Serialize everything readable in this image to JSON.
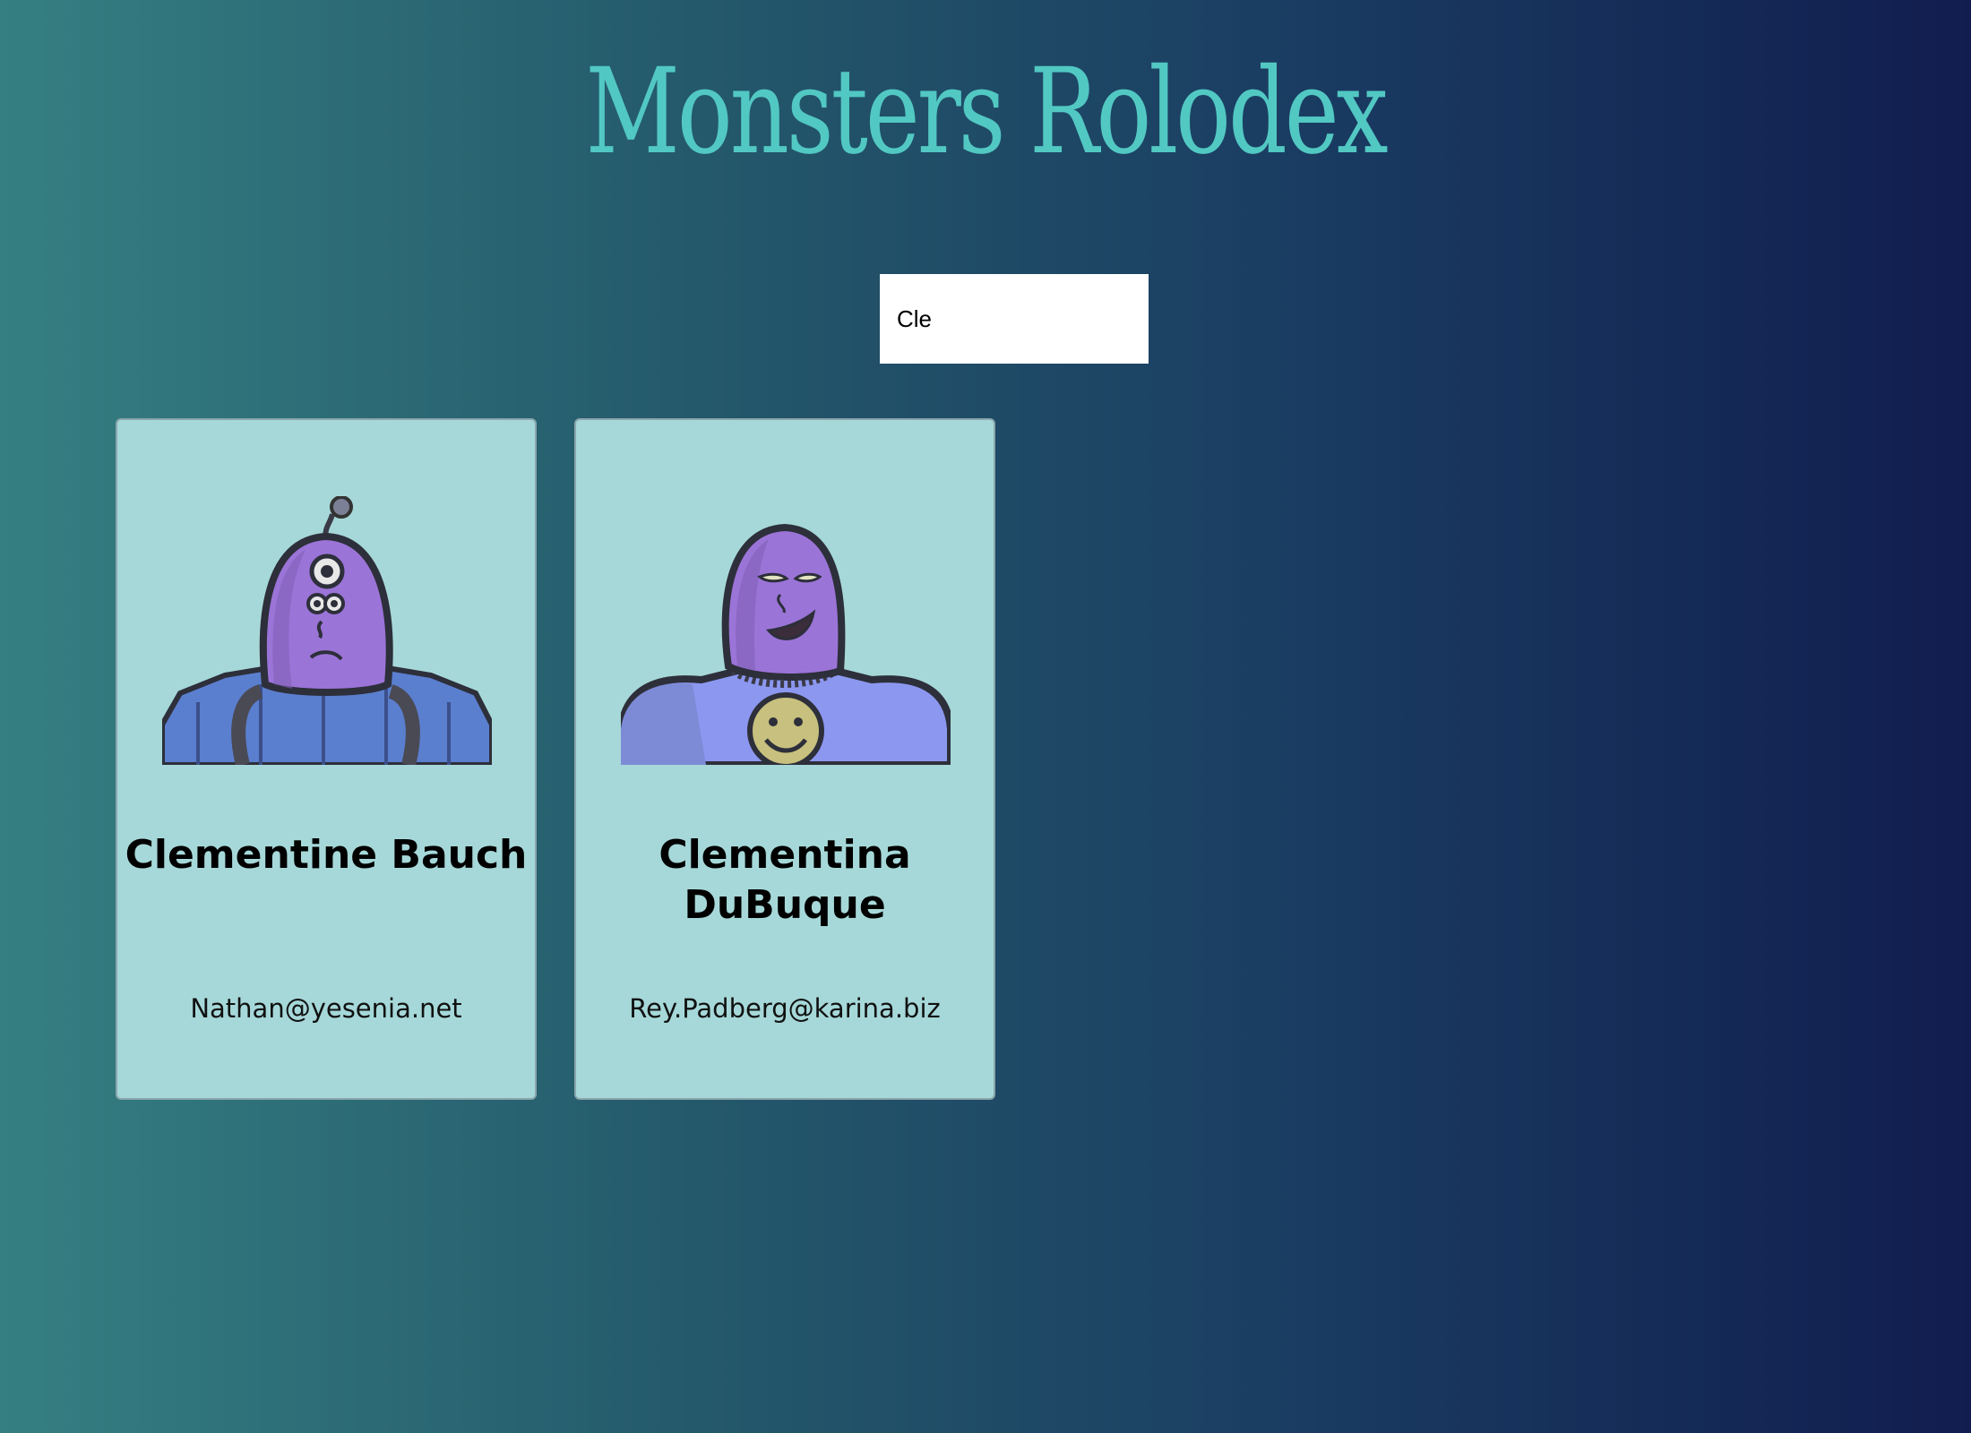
{
  "app": {
    "title": "Monsters Rolodex"
  },
  "search": {
    "value": "Cle",
    "placeholder": "search monsters"
  },
  "monsters": [
    {
      "name": "Clementine Bauch",
      "email": "Nathan@yesenia.net",
      "avatar_icon": "robot-cyclops-monster-avatar"
    },
    {
      "name": "Clementina DuBuque",
      "email": "Rey.Padberg@karina.biz",
      "avatar_icon": "smiley-monster-avatar"
    }
  ],
  "colors": {
    "title": "#52c8c3",
    "card_background": "#a6d8d9",
    "gradient_start": "#357f82",
    "gradient_end": "#111d4f",
    "monster_skin": "#9b74d8",
    "armor_blue": "#5b7fcf"
  }
}
